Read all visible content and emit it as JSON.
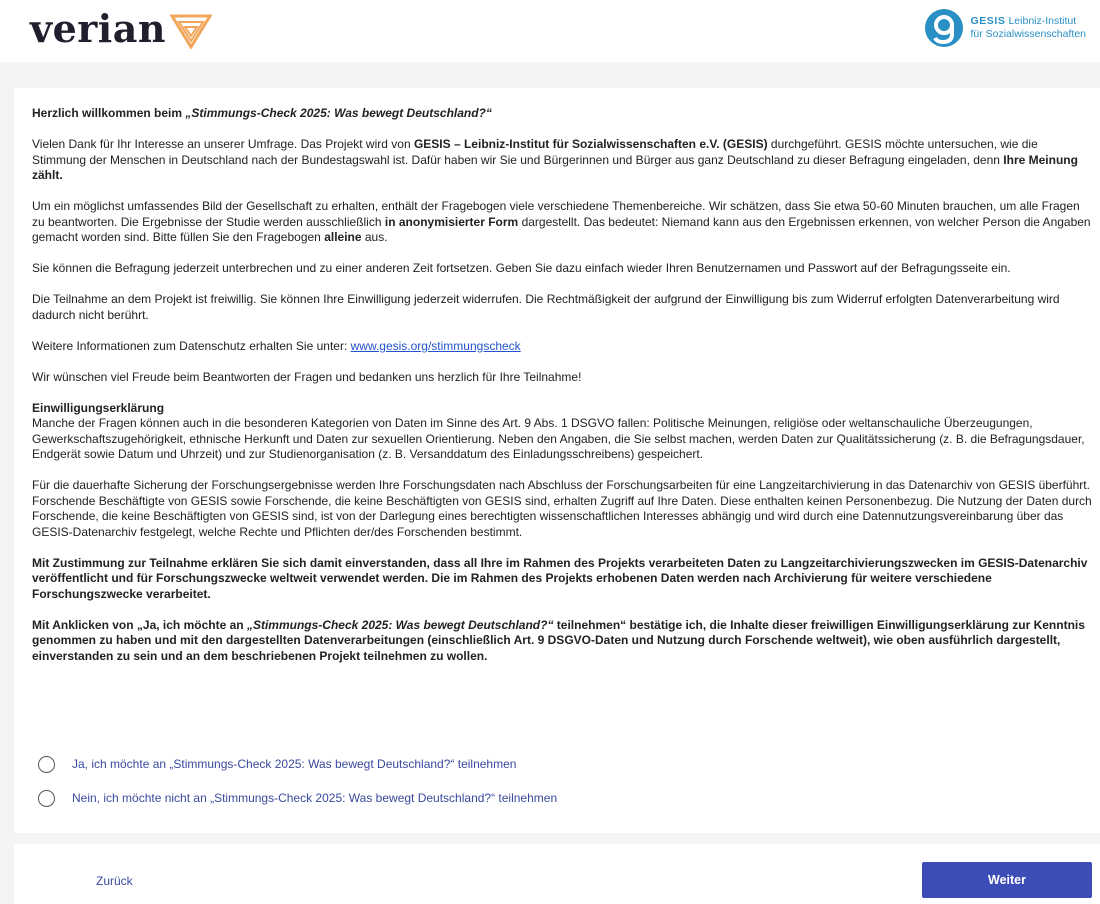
{
  "header": {
    "brand": "verian",
    "partner_name": "GESIS",
    "partner_line1": "Leibniz-Institut",
    "partner_line2": "für Sozialwissenschaften"
  },
  "intro": {
    "title_prefix": "Herzlich willkommen beim ",
    "title_survey": "„Stimmungs-Check 2025: Was bewegt Deutschland?“"
  },
  "paragraphs": {
    "p1_a": "Vielen Dank für Ihr Interesse an unserer Umfrage. Das Projekt wird von ",
    "p1_b": "GESIS – Leibniz-Institut für Sozialwissenschaften e.V. (GESIS)",
    "p1_c": " durchgeführt. GESIS möchte untersuchen, wie die Stimmung der Menschen in Deutschland nach der Bundestagswahl ist. Dafür haben wir Sie und Bürgerinnen und Bürger aus ganz Deutschland zu dieser Befragung eingeladen, denn ",
    "p1_d": "Ihre Meinung zählt.",
    "p2_a": "Um ein möglichst umfassendes Bild der Gesellschaft zu erhalten, enthält der Fragebogen viele verschiedene Themenbereiche. Wir schätzen, dass Sie etwa 50-60 Minuten brauchen, um alle Fragen zu beantworten. Die Ergebnisse der Studie werden ausschließlich ",
    "p2_b": "in anonymisierter Form",
    "p2_c": " dargestellt. Das bedeutet: Niemand kann aus den Ergebnissen erkennen, von welcher Person die Angaben gemacht worden sind. Bitte füllen Sie den Fragebogen ",
    "p2_d": "alleine",
    "p2_e": " aus.",
    "p3": "Sie können die Befragung jederzeit unterbrechen und zu einer anderen Zeit fortsetzen. Geben Sie dazu einfach wieder Ihren Benutzernamen und Passwort auf der Befragungsseite ein.",
    "p4": "Die Teilnahme an dem Projekt ist freiwillig. Sie können Ihre Einwilligung jederzeit widerrufen. Die Rechtmäßigkeit der aufgrund der Einwilligung bis zum Widerruf erfolgten Datenverarbeitung wird dadurch nicht berührt.",
    "p5_a": "Weitere Informationen zum Datenschutz erhalten Sie unter: ",
    "p5_link": "www.gesis.org/stimmungscheck",
    "p6": "Wir wünschen viel Freude beim Beantworten der Fragen und bedanken uns herzlich für Ihre Teilnahme!",
    "consent_heading": "Einwilligungserklärung",
    "p7": "Manche der Fragen können auch in die besonderen Kategorien von Daten im Sinne des Art. 9 Abs. 1 DSGVO fallen: Politische Meinungen, religiöse oder weltanschauliche Überzeugungen, Gewerkschaftszugehörigkeit, ethnische Herkunft und Daten zur sexuellen Orientierung. Neben den Angaben, die Sie selbst machen, werden Daten zur Qualitätssicherung (z. B. die Befragungsdauer, Endgerät sowie Datum und Uhrzeit) und zur Studienorganisation (z. B. Versanddatum des Einladungsschreibens) gespeichert.",
    "p8": "Für die dauerhafte Sicherung der Forschungsergebnisse werden Ihre Forschungsdaten nach Abschluss der Forschungsarbeiten für eine Langzeitarchivierung in das Datenarchiv von GESIS überführt. Forschende Beschäftigte von GESIS sowie Forschende, die keine Beschäftigten von GESIS sind, erhalten Zugriff auf Ihre Daten. Diese enthalten keinen Personenbezug. Die Nutzung der Daten durch Forschende, die keine Beschäftigten von GESIS sind, ist von der Darlegung eines berechtigten wissenschaftlichen Interesses abhängig und wird durch eine Datennutzungsvereinbarung über das GESIS-Datenarchiv festgelegt, welche Rechte und Pflichten der/des Forschenden bestimmt.",
    "p9": "Mit Zustimmung zur Teilnahme erklären Sie sich damit einverstanden, dass all Ihre im Rahmen des Projekts verarbeiteten Daten zu Langzeitarchivierungszwecken im GESIS-Datenarchiv veröffentlicht und für Forschungszwecke weltweit verwendet werden. Die im Rahmen des Projekts erhobenen Daten werden nach Archivierung für weitere verschiedene Forschungszwecke verarbeitet.",
    "p10_a": "Mit Anklicken von „Ja, ich möchte an ",
    "p10_b": "„Stimmungs-Check 2025: Was bewegt Deutschland?“",
    "p10_c": " teilnehmen“ bestätige ich, die Inhalte dieser freiwilligen Einwilligungserklärung zur Kenntnis genommen zu haben und mit den dargestellten Datenverarbeitungen (einschließlich Art. 9 DSGVO-Daten und Nutzung durch Forschende weltweit), wie oben ausführlich dargestellt, einverstanden zu sein und an dem beschriebenen Projekt teilnehmen zu wollen."
  },
  "options": [
    {
      "label": "Ja, ich möchte an „Stimmungs-Check 2025: Was bewegt Deutschland?“ teilnehmen",
      "selected": false
    },
    {
      "label": "Nein, ich möchte nicht an „Stimmungs-Check 2025: Was bewegt Deutschland?“ teilnehmen",
      "selected": false
    }
  ],
  "nav": {
    "back_label": "Zurück",
    "next_label": "Weiter"
  },
  "colors": {
    "accent": "#3d4db7",
    "link": "#2255cc",
    "verian_mark": "#f2a65a",
    "gesis_blue": "#2a8fc4"
  }
}
